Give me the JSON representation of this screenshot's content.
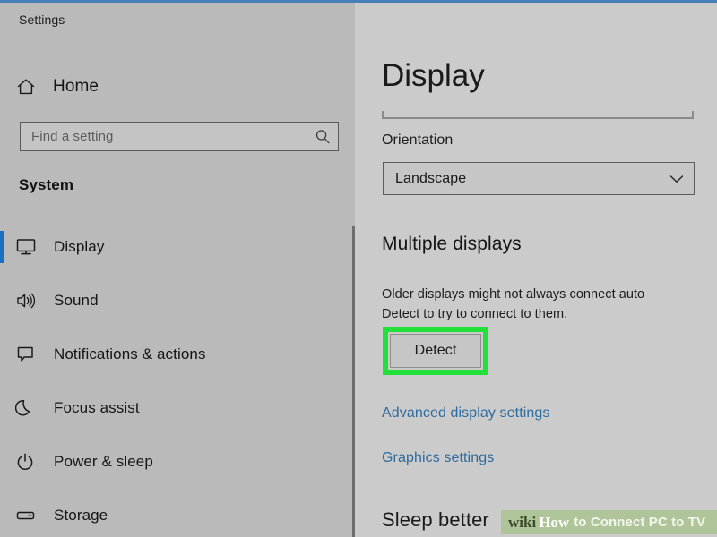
{
  "window": {
    "title": "Settings",
    "accent_color": "#4a7ebb",
    "sidebar_bg": "#bababa",
    "content_bg": "#cbcbcb"
  },
  "sidebar": {
    "home": {
      "label": "Home",
      "icon": "home-icon"
    },
    "search": {
      "placeholder": "Find a setting",
      "icon": "search-icon",
      "value": ""
    },
    "section_header": "System",
    "selection_color": "#1b6ec2",
    "items": [
      {
        "label": "Display",
        "icon": "monitor-icon",
        "selected": true
      },
      {
        "label": "Sound",
        "icon": "speaker-icon",
        "selected": false
      },
      {
        "label": "Notifications & actions",
        "icon": "speech-bubble-icon",
        "selected": false
      },
      {
        "label": "Focus assist",
        "icon": "moon-icon",
        "selected": false
      },
      {
        "label": "Power & sleep",
        "icon": "power-icon",
        "selected": false
      },
      {
        "label": "Storage",
        "icon": "drive-icon",
        "selected": false
      }
    ]
  },
  "content": {
    "page_title": "Display",
    "orientation": {
      "label": "Orientation",
      "selected_value": "Landscape",
      "icon": "chevron-down-icon"
    },
    "multiple_displays": {
      "title": "Multiple displays",
      "description_line_1": "Older displays might not always connect auto",
      "description_line_2": "Detect to try to connect to them.",
      "detect_button": "Detect",
      "highlight_color": "#22e03a"
    },
    "links": [
      {
        "label": "Advanced display settings"
      },
      {
        "label": "Graphics settings"
      }
    ],
    "link_color": "#2e6b9e",
    "bottom_heading": "Sleep better"
  },
  "watermark": {
    "wiki": "wiki",
    "how": "How",
    "rest": "to Connect PC to TV",
    "background": "#a8c28d"
  }
}
